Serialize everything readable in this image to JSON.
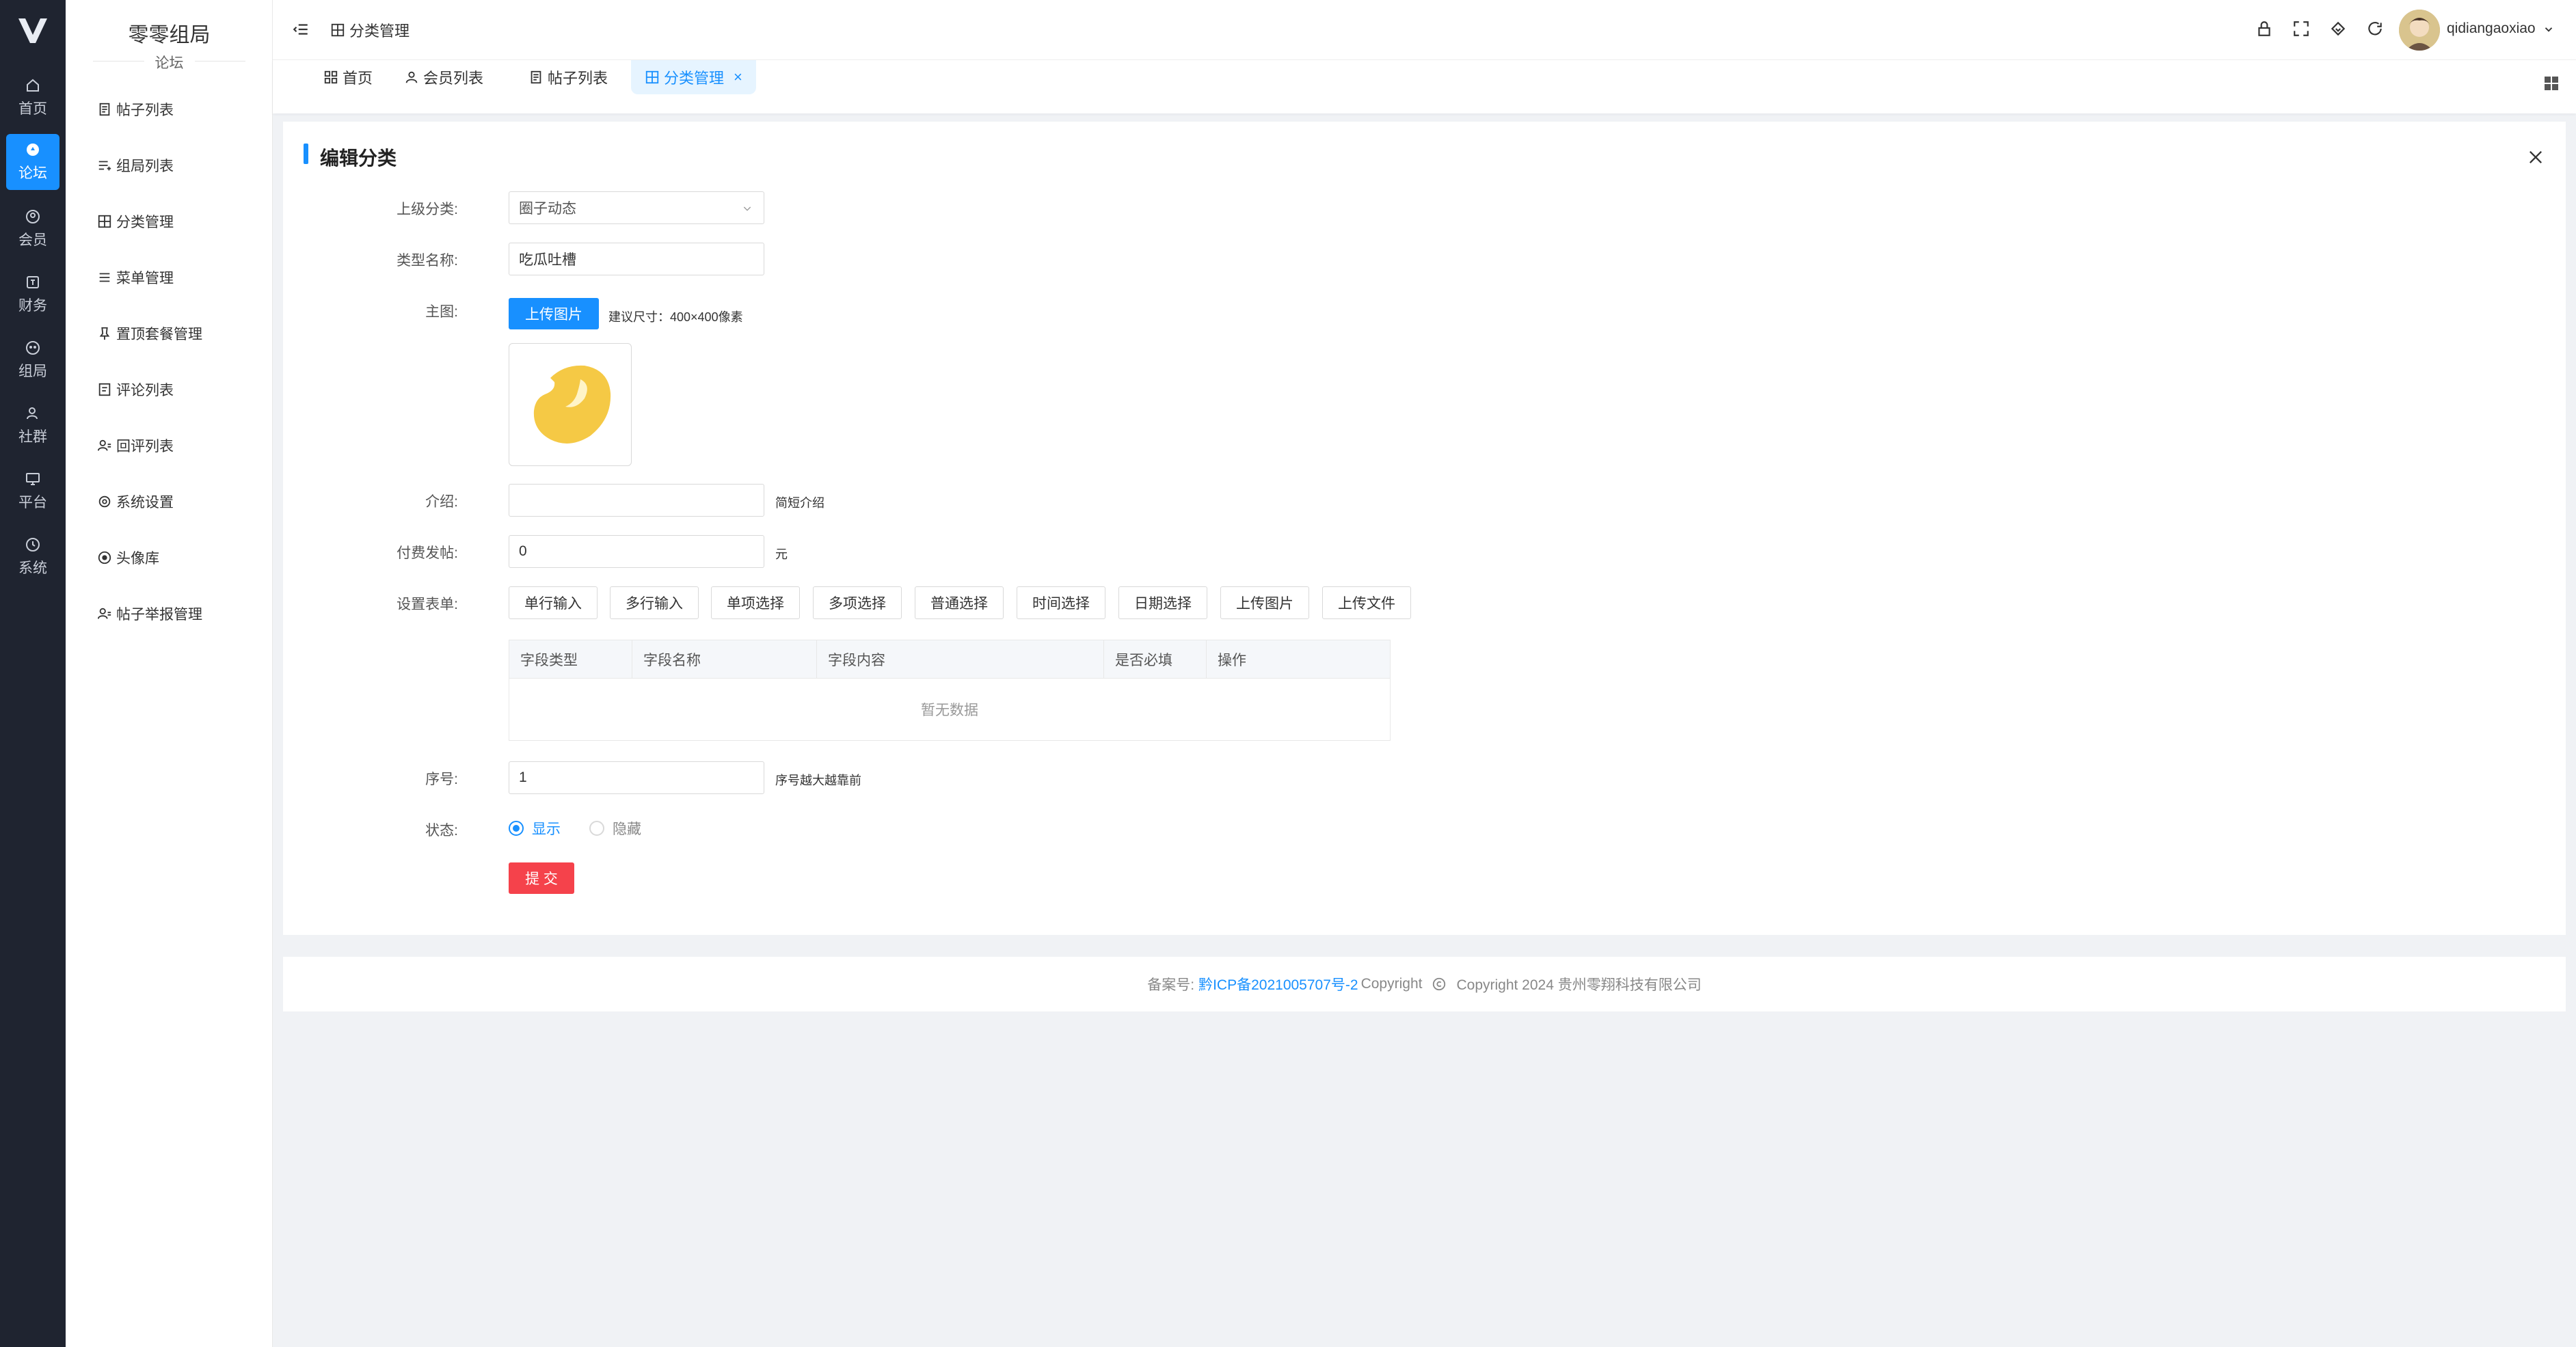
{
  "rail": {
    "items": [
      {
        "label": "首页",
        "icon": "home-icon"
      },
      {
        "label": "论坛",
        "icon": "forum-icon",
        "active": true
      },
      {
        "label": "会员",
        "icon": "member-icon"
      },
      {
        "label": "财务",
        "icon": "finance-icon"
      },
      {
        "label": "组局",
        "icon": "group-icon"
      },
      {
        "label": "社群",
        "icon": "community-icon"
      },
      {
        "label": "平台",
        "icon": "monitor-icon"
      },
      {
        "label": "系统",
        "icon": "system-icon"
      }
    ]
  },
  "sidebar": {
    "title": "零零组局",
    "subtitle": "论坛",
    "items": [
      {
        "label": "帖子列表",
        "icon": "doc-icon"
      },
      {
        "label": "组局列表",
        "icon": "list-icon"
      },
      {
        "label": "分类管理",
        "icon": "grid-icon"
      },
      {
        "label": "菜单管理",
        "icon": "menu-icon"
      },
      {
        "label": "置顶套餐管理",
        "icon": "pin-icon"
      },
      {
        "label": "评论列表",
        "icon": "comment-icon"
      },
      {
        "label": "回评列表",
        "icon": "user-list-icon"
      },
      {
        "label": "系统设置",
        "icon": "settings-icon"
      },
      {
        "label": "头像库",
        "icon": "avatar-icon"
      },
      {
        "label": "帖子举报管理",
        "icon": "report-icon"
      }
    ]
  },
  "header": {
    "breadcrumb": "分类管理",
    "username": "qidiangaoxiao"
  },
  "tabs": [
    {
      "label": "首页"
    },
    {
      "label": "会员列表"
    },
    {
      "label": "帖子列表"
    },
    {
      "label": "分类管理",
      "active": true,
      "close": "×"
    }
  ],
  "form": {
    "title": "编辑分类",
    "parent_label": "上级分类:",
    "parent_value": "圈子动态",
    "name_label": "类型名称:",
    "name_value": "吃瓜吐槽",
    "image_label": "主图:",
    "upload_button": "上传图片",
    "upload_hint": "建议尺寸：400×400像素",
    "intro_label": "介绍:",
    "intro_value": "",
    "intro_hint": "简短介绍",
    "fee_label": "付费发帖:",
    "fee_value": "0",
    "fee_unit": "元",
    "formset_label": "设置表单:",
    "form_buttons": [
      "单行输入",
      "多行输入",
      "单项选择",
      "多项选择",
      "普通选择",
      "时间选择",
      "日期选择",
      "上传图片",
      "上传文件"
    ],
    "table_headers": [
      "字段类型",
      "字段名称",
      "字段内容",
      "是否必填",
      "操作"
    ],
    "table_empty": "暂无数据",
    "order_label": "序号:",
    "order_value": "1",
    "order_hint": "序号越大越靠前",
    "status_label": "状态:",
    "status_show": "显示",
    "status_hide": "隐藏",
    "status_selected": "显示",
    "submit": "提 交"
  },
  "footer": {
    "prefix": "备案号:",
    "icp": "黔ICP备2021005707号-2",
    "copyright_word": "Copyright",
    "text": "Copyright  2024 贵州零翔科技有限公司"
  },
  "colors": {
    "accent": "#1890ff",
    "danger": "#f5424b",
    "rail_bg": "#1f2430",
    "bean": "#f5c945"
  }
}
